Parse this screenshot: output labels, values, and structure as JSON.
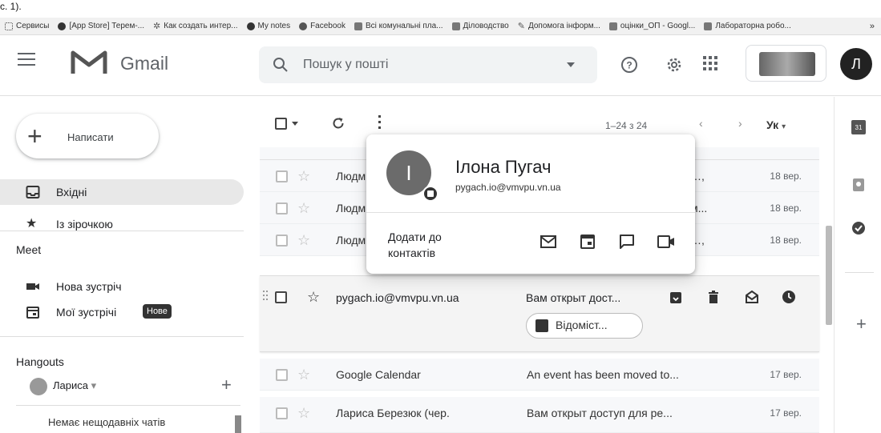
{
  "doc_text": "с. 1).",
  "bookmarks": [
    {
      "label": "Сервисы",
      "icon": "apps-grid-icon"
    },
    {
      "label": "[App Store] Терем-...",
      "icon": "globe-icon"
    },
    {
      "label": "Как создать интер...",
      "icon": "sparkle-icon"
    },
    {
      "label": "My notes",
      "icon": "globe-icon"
    },
    {
      "label": "Facebook",
      "icon": "facebook-icon"
    },
    {
      "label": "Всі комунальні пла...",
      "icon": "bookmark-icon"
    },
    {
      "label": "Діловодство",
      "icon": "bookmark-icon"
    },
    {
      "label": "Допомога інформ...",
      "icon": "pencil-icon"
    },
    {
      "label": "оцінки_ОП - Googl...",
      "icon": "sheets-icon"
    },
    {
      "label": "Лабораторна робо...",
      "icon": "bookmark-icon"
    }
  ],
  "bookmarks_more": "»",
  "header": {
    "logo_text": "Gmail",
    "search_placeholder": "Пошук у пошті",
    "avatar_letter": "Л"
  },
  "sidebar": {
    "compose_label": "Написати",
    "items": [
      {
        "label": "Вхідні",
        "icon": "inbox-icon",
        "active": true
      },
      {
        "label": "Із зірочкою",
        "icon": "star-icon",
        "active": false
      }
    ],
    "meet_title": "Meet",
    "meet_items": [
      {
        "label": "Нова зустріч",
        "icon": "video-icon"
      },
      {
        "label": "Мої зустрічі",
        "icon": "calendar-icon",
        "badge": "Нове"
      }
    ],
    "hangouts_title": "Hangouts",
    "hangouts_user": "Лариса",
    "no_chats": "Немає нещодавніх чатів"
  },
  "toolbar": {
    "pager": "1–24 з 24",
    "lang": "Ук"
  },
  "emails": [
    {
      "sender": "Людм",
      "subject": "…,",
      "date": "18 вер."
    },
    {
      "sender": "Людм",
      "subject": "м...",
      "date": "18 вер."
    },
    {
      "sender": "Людм",
      "subject": "…,",
      "date": "18 вер."
    }
  ],
  "hover_email": {
    "sender": "pygach.io@vmvpu.vn.ua",
    "subject": "Вам открыт дост...",
    "attachment": "Відоміст..."
  },
  "emails_bottom": [
    {
      "sender": "Google Calendar",
      "subject": "An event has been moved to...",
      "date": "17 вер."
    },
    {
      "sender": "Лариса Березюк (чер.",
      "subject": "Вам открыт доступ для ре...",
      "date": "17 вер."
    }
  ],
  "contact_card": {
    "initial": "I",
    "name": "Ілона Пугач",
    "email": "pygach.io@vmvpu.vn.ua",
    "add_line1": "Додати до",
    "add_line2": "контактів"
  },
  "rail": {
    "calendar_day": "31",
    "plus": "+"
  },
  "colors": {
    "search_bg": "#f1f3f4",
    "active_nav": "#e8e8e8",
    "avatar": "#222222"
  }
}
